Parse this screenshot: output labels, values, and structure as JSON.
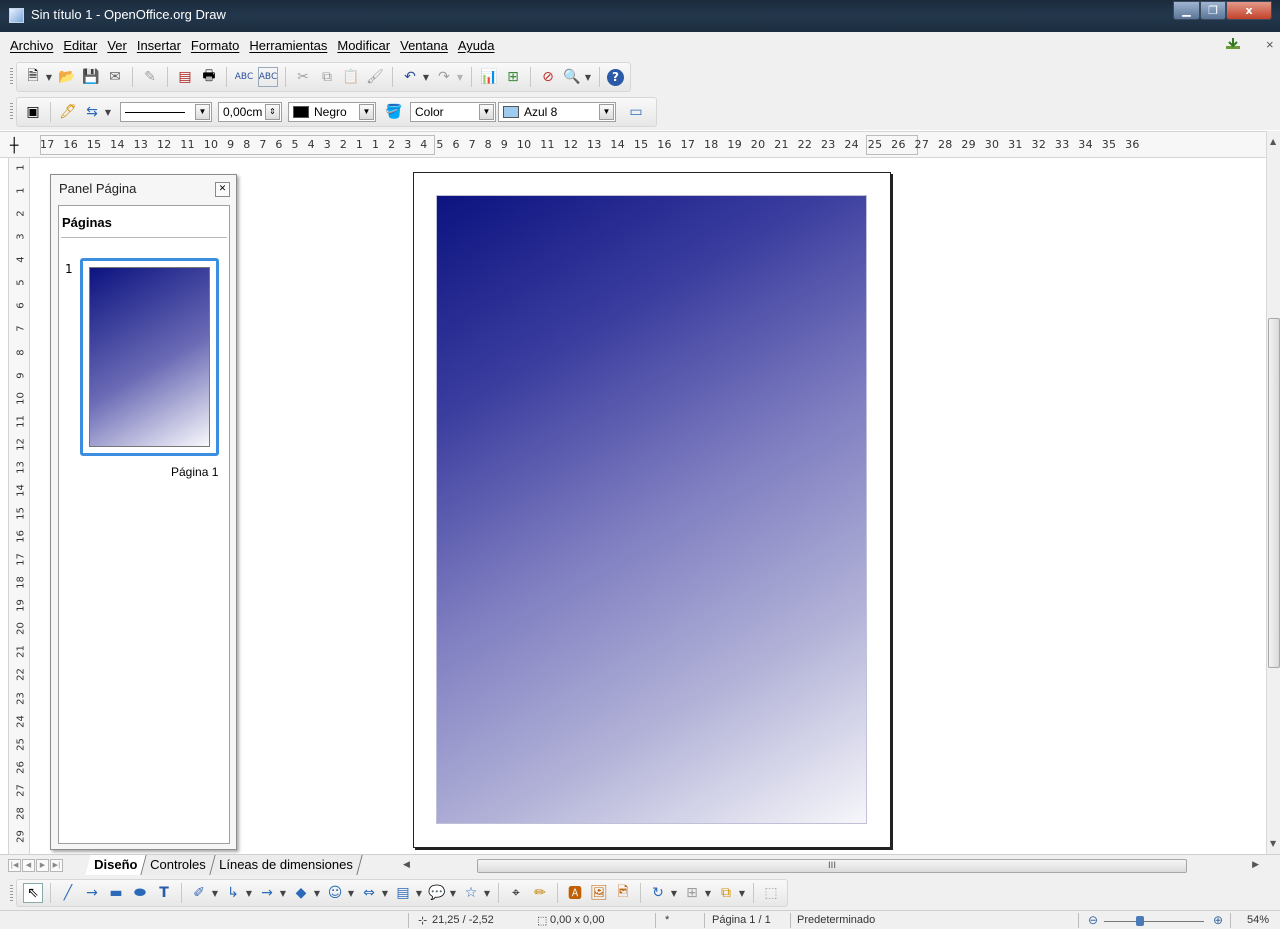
{
  "window": {
    "title": "Sin título 1 - OpenOffice.org Draw",
    "close_label": "x"
  },
  "menu": {
    "items": [
      "Archivo",
      "Editar",
      "Ver",
      "Insertar",
      "Formato",
      "Herramientas",
      "Modificar",
      "Ventana",
      "Ayuda"
    ],
    "doc_close": "×"
  },
  "line_toolbar": {
    "line_width": "0,00cm",
    "line_color": "Negro",
    "line_color_hex": "#000000",
    "area_style": "Color",
    "area_color": "Azul 8",
    "area_color_hex": "#9ecbf0"
  },
  "ruler": {
    "horizontal": "17 16 15 14 13 12 11 10 9 8 7 6 5 4 3 2 1     1 2 3 4 5 6 7 8 9 10 11 12 13 14 15 16 17 18 19 20 21 22 23 24 25 26 27 28 29 30 31 32 33 34 35 36",
    "vertical": [
      "1",
      "1",
      "2",
      "3",
      "4",
      "5",
      "6",
      "7",
      "8",
      "9",
      "10",
      "11",
      "12",
      "13",
      "14",
      "15",
      "16",
      "17",
      "18",
      "19",
      "20",
      "21",
      "22",
      "23",
      "24",
      "25",
      "26",
      "27",
      "28",
      "29"
    ]
  },
  "page_panel": {
    "title": "Panel Página",
    "heading": "Páginas",
    "page_number": "1",
    "page_name": "Página 1"
  },
  "tabs": [
    {
      "label": "Diseño",
      "active": true
    },
    {
      "label": "Controles",
      "active": false
    },
    {
      "label": "Líneas de dimensiones",
      "active": false
    }
  ],
  "hscroll_grip": "III",
  "status": {
    "position": "21,25 / -2,52",
    "size": "0,00 x 0,00",
    "modified": "*",
    "page": "Página 1 / 1",
    "layout": "Predeterminado",
    "zoom": "54%",
    "zoom_level": 0.54
  },
  "colors": {
    "gradient_start": "#0c1380",
    "gradient_end": "#f6f6fa",
    "selection": "#3c8ee0"
  }
}
